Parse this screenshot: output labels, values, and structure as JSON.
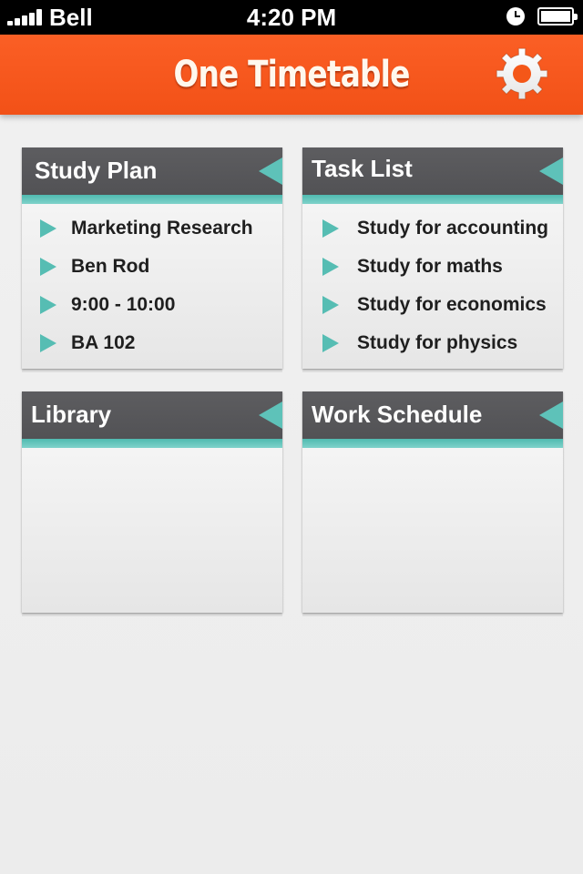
{
  "status_bar": {
    "carrier": "Bell",
    "time": "4:20 PM",
    "icons": [
      "signal-icon",
      "clock-icon",
      "battery-icon"
    ]
  },
  "header": {
    "title": "One Timetable",
    "settings_icon": "gear-icon"
  },
  "colors": {
    "accent": "#f55a1e",
    "card_header": "#58585b",
    "teal": "#5ec2b9",
    "background": "#eeeeee"
  },
  "cards": {
    "study_plan": {
      "title": "Study Plan",
      "items": [
        "Marketing Research",
        "Ben Rod",
        "9:00 - 10:00",
        "BA 102"
      ]
    },
    "task_list": {
      "title": "Task List",
      "items": [
        "Study for accounting",
        "Study for maths",
        "Study for economics",
        "Study for physics"
      ]
    },
    "library": {
      "title": "Library",
      "items": []
    },
    "work_schedule": {
      "title": "Work Schedule",
      "items": []
    }
  }
}
